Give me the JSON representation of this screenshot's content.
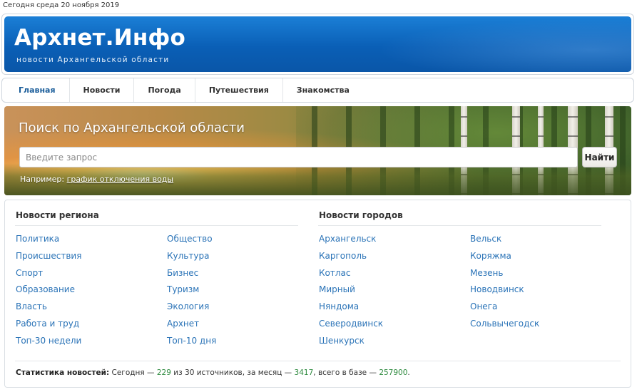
{
  "date_line": "Сегодня среда 20 ноября 2019",
  "header": {
    "logo": "Архнет.Инфо",
    "tagline": "новости Архангельской области"
  },
  "nav": {
    "items": [
      {
        "label": "Главная",
        "active": true
      },
      {
        "label": "Новости"
      },
      {
        "label": "Погода"
      },
      {
        "label": "Путешествия"
      },
      {
        "label": "Знакомства"
      }
    ]
  },
  "search": {
    "title": "Поиск по Архангельской области",
    "placeholder": "Введите запрос",
    "button_label": "Найти",
    "example_prefix": "Например:",
    "example_link": "график отключения воды"
  },
  "region_news": {
    "title": "Новости региона",
    "col1": [
      "Политика",
      "Происшествия",
      "Спорт",
      "Образование",
      "Власть",
      "Работа и труд",
      "Топ-30 недели"
    ],
    "col2": [
      "Общество",
      "Культура",
      "Бизнес",
      "Туризм",
      "Экология",
      "Архнет",
      "Топ-10 дня"
    ]
  },
  "city_news": {
    "title": "Новости городов",
    "col1": [
      "Архангельск",
      "Каргополь",
      "Котлас",
      "Мирный",
      "Няндома",
      "Северодвинск",
      "Шенкурск"
    ],
    "col2": [
      "Вельск",
      "Коряжма",
      "Мезень",
      "Новодвинск",
      "Онега",
      "Сольвычегодск"
    ]
  },
  "stats": {
    "label": "Статистика новостей:",
    "today_prefix": "Сегодня —",
    "today_count": "229",
    "sources_text": "из 30 источников, за месяц —",
    "month_count": "3417",
    "total_text": ", всего в базе —",
    "total_count": "257900",
    "end": "."
  },
  "colors": {
    "header_blue": "#0a5fb6",
    "link_blue": "#2a73b7",
    "stat_green": "#2d8a3e",
    "active_nav": "#1a5d9a"
  }
}
